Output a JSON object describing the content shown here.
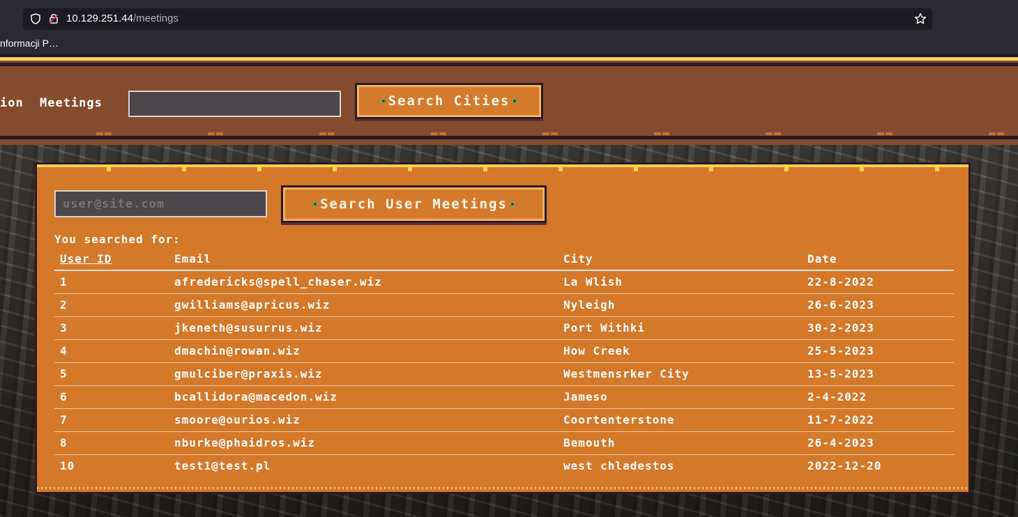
{
  "browser": {
    "url_host": "10.129.251.44",
    "url_path": "/meetings",
    "bookmark": "nformacji P…"
  },
  "nav": {
    "partial_link": "ion",
    "meetings_link": "Meetings",
    "search_placeholder": "",
    "search_button": "Search Cities"
  },
  "main": {
    "user_placeholder": "user@site.com",
    "search_button": "Search User Meetings",
    "searched_label": "You searched for:",
    "columns": [
      "User ID",
      "Email",
      "City",
      "Date"
    ],
    "rows": [
      [
        "1",
        "afredericks@spell_chaser.wiz",
        "La Wlish",
        "22-8-2022"
      ],
      [
        "2",
        "gwilliams@apricus.wiz",
        "Nyleigh",
        "26-6-2023"
      ],
      [
        "3",
        "jkeneth@susurrus.wiz",
        "Port Withki",
        "30-2-2023"
      ],
      [
        "4",
        "dmachin@rowan.wiz",
        "How Creek",
        "25-5-2023"
      ],
      [
        "5",
        "gmulciber@praxis.wiz",
        "Westmensrker City",
        "13-5-2023"
      ],
      [
        "6",
        "bcallidora@macedon.wiz",
        "Jameso",
        "2-4-2022"
      ],
      [
        "7",
        "smoore@ourios.wiz",
        "Coortenterstone",
        "11-7-2022"
      ],
      [
        "8",
        "nburke@phaidros.wiz",
        "Bemouth",
        "26-4-2023"
      ],
      [
        "10",
        "test1@test.pl",
        "west chladestos",
        "2022-12-20"
      ]
    ]
  },
  "colors": {
    "panel": "#d4782a",
    "navbar": "#854b2f",
    "accent_yellow": "#f5d24e",
    "dark_outline": "#2b1a23"
  },
  "icons": [
    "shield-icon",
    "lock-icon",
    "star-icon",
    "stud-icon"
  ]
}
